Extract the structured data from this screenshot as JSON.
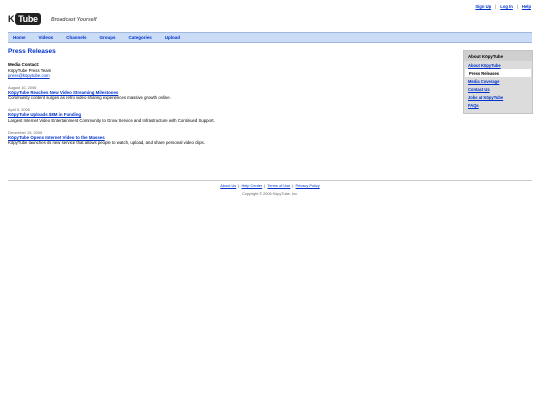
{
  "top_links": [
    "Sign Up",
    "Log In",
    "Help"
  ],
  "logo": {
    "k": "K",
    "tube": "Tube",
    "brand_full": "KöpyTube"
  },
  "tagline": "Broadcast Yourself",
  "nav": [
    "Home",
    "Videos",
    "Channels",
    "Groups",
    "Categories",
    "Upload"
  ],
  "main": {
    "title": "Press Releases",
    "contact_heading": "Media Contact:",
    "contact_team": "KöpyTube Press Team",
    "contact_email": "press@köpytube.com",
    "releases": [
      {
        "date": "August 10, 2006",
        "title": "KöpyTube Reaches New Video Streaming Milestones",
        "desc": "Community content surges as retro video sharing experiences massive growth online."
      },
      {
        "date": "April 5, 2006",
        "title": "KöpyTube Uploads $8M in Funding",
        "desc": "Largest Internet Video Entertainment Community to Grow Service and Infrastructure with Continued Support."
      },
      {
        "date": "December 15, 2005",
        "title": "KöpyTube Opens Internet Video to the Masses",
        "desc": "KöpyTube launches its new service that allows people to watch, upload, and share personal video clips."
      }
    ]
  },
  "sidebar": {
    "heading": "About KöpyTube",
    "items": [
      {
        "label": "About KöpyTube",
        "active": false
      },
      {
        "label": "Press Releases",
        "active": true
      },
      {
        "label": "Media Coverage",
        "active": false
      },
      {
        "label": "Contact Us",
        "active": false
      },
      {
        "label": "Jobs at KöpyTube",
        "active": false
      },
      {
        "label": "FAQs",
        "active": false
      }
    ]
  },
  "footer": {
    "links": [
      "About Us",
      "Help Center",
      "Terms of Use",
      "Privacy Policy"
    ],
    "copyright": "Copyright © 2006 KöpyTube, Inc."
  },
  "colors": {
    "link": "#0033cc",
    "navbar_bg": "#cbdcf7",
    "sidebar_bg": "#dcdcdc"
  }
}
